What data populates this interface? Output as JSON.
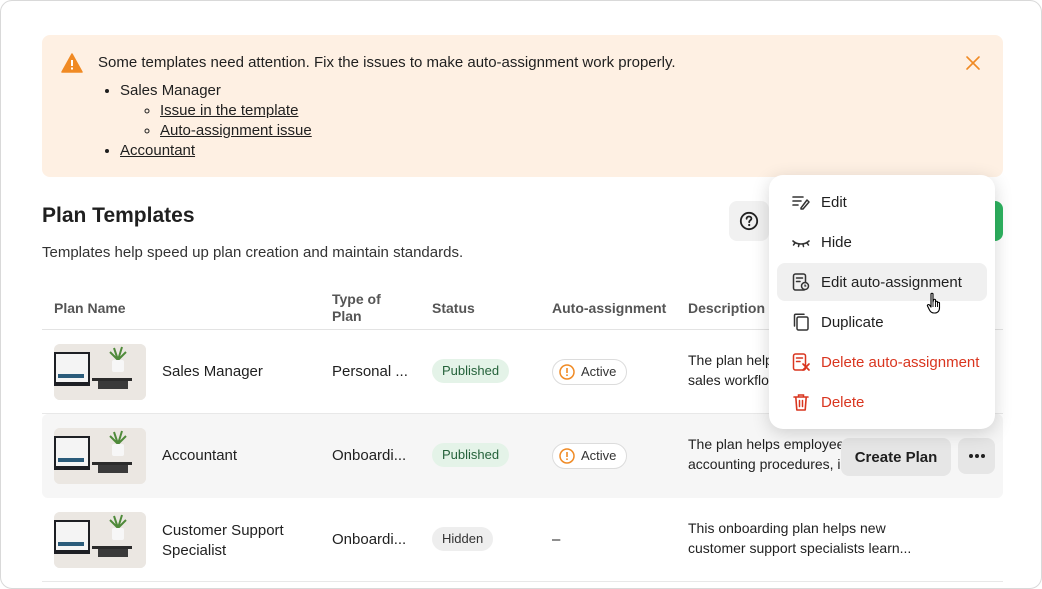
{
  "alert": {
    "title": "Some templates need attention. Fix the issues to make auto-assignment work properly.",
    "items": [
      {
        "label": "Sales Manager",
        "sub": [
          "Issue in the template",
          "Auto-assignment issue"
        ]
      },
      {
        "label": "Accountant"
      }
    ],
    "accent": "#f08a24",
    "background": "#fef0e3"
  },
  "header": {
    "title": "Plan Templates",
    "subtitle": "Templates help speed up plan creation and maintain standards."
  },
  "table": {
    "columns": [
      "Plan Name",
      "Type of Plan",
      "Status",
      "Auto-assignment",
      "Description"
    ],
    "column_lines": {
      "type": [
        "Type of",
        "Plan"
      ]
    },
    "rows": [
      {
        "name": "Sales Manager",
        "type": "Personal ...",
        "status": "Published",
        "auto": "Active",
        "desc": [
          "The plan helps",
          "sales workflo"
        ]
      },
      {
        "name": "Accountant",
        "type": "Onboardi...",
        "status": "Published",
        "auto": "Active",
        "desc": [
          "The plan helps employee",
          "accounting procedures, i"
        ],
        "create_label": "Create Plan"
      },
      {
        "name_lines": [
          "Customer Support",
          "Specialist"
        ],
        "type": "Onboardi...",
        "status": "Hidden",
        "auto": "–",
        "desc": [
          "This onboarding plan helps new",
          "customer support specialists learn..."
        ]
      }
    ]
  },
  "menu": {
    "items": [
      {
        "label": "Edit",
        "icon": "edit-icon"
      },
      {
        "label": "Hide",
        "icon": "eye-closed-icon"
      },
      {
        "label": "Edit auto-assignment",
        "icon": "edit-auto-assignment-icon",
        "hovered": true
      },
      {
        "label": "Duplicate",
        "icon": "duplicate-icon"
      },
      {
        "label": "Delete auto-assignment",
        "icon": "delete-auto-assignment-icon",
        "danger": true
      },
      {
        "label": "Delete",
        "icon": "trash-icon",
        "danger": true
      }
    ]
  },
  "colors": {
    "primary_green": "#2eb360",
    "danger": "#d9351f",
    "warning": "#f08a24",
    "published_bg": "#e4f3e8"
  }
}
